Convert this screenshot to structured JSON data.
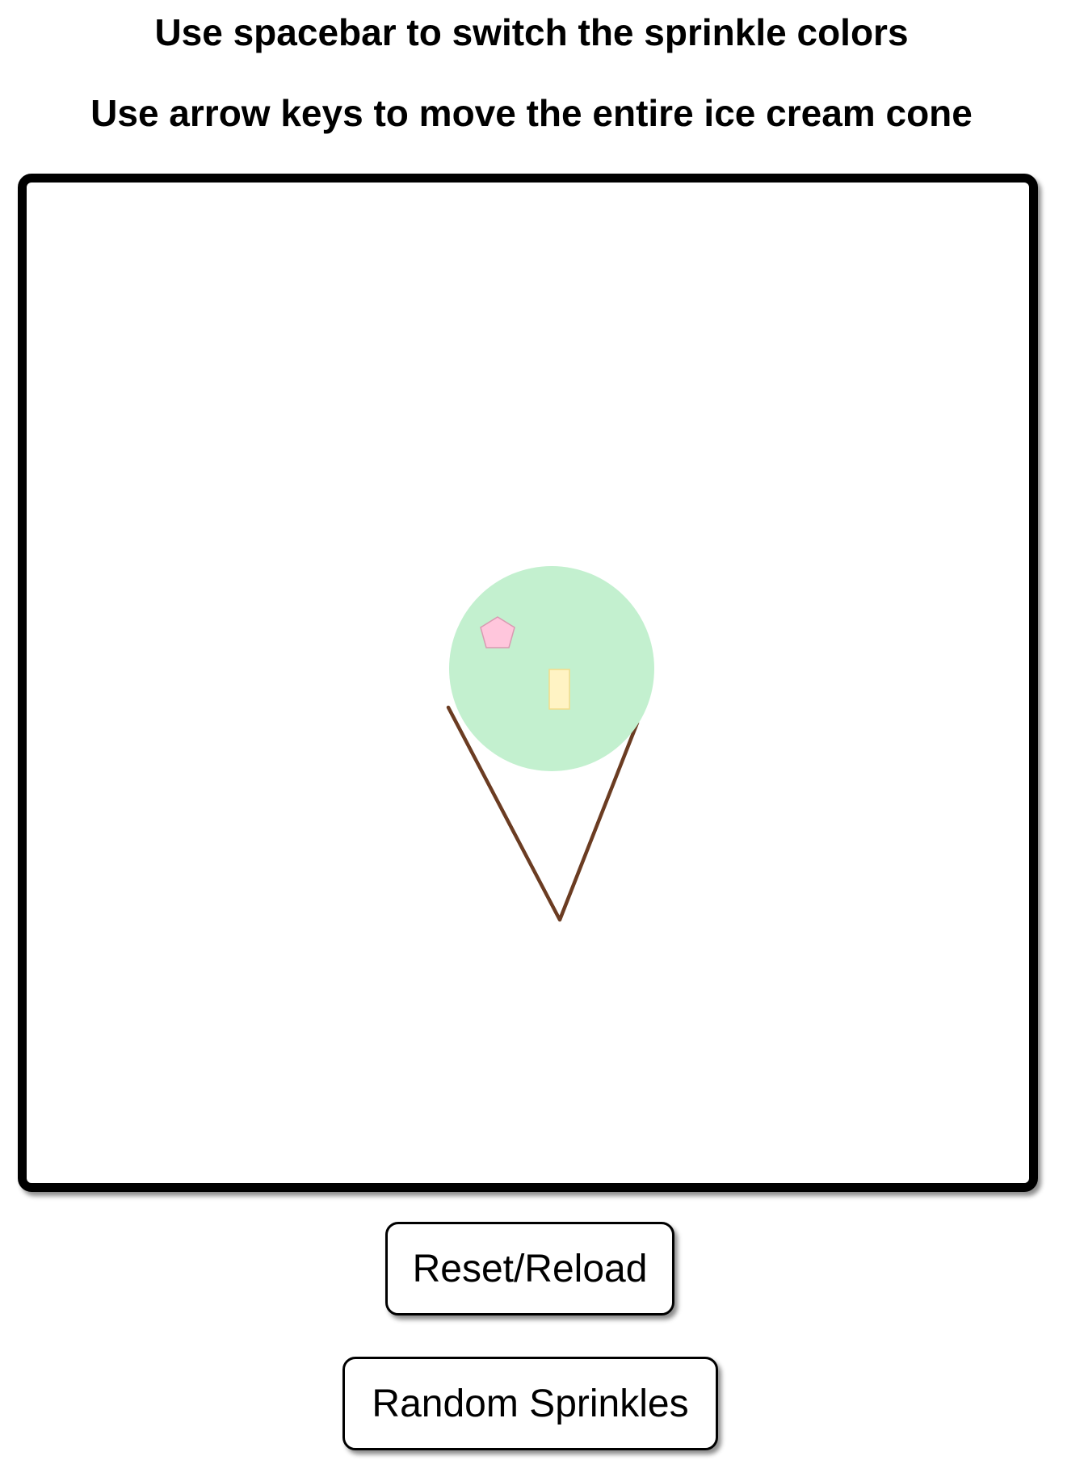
{
  "instructions": {
    "line1": "Use spacebar to switch the sprinkle colors",
    "line2": "Use arrow keys to move the entire ice cream cone"
  },
  "scene": {
    "scoop_color": "#c3f0cf",
    "cone_color": "#6b3c22",
    "sprinkles": [
      {
        "shape": "pentagon",
        "fill": "#ffc6dc",
        "stroke": "#d99ab2"
      },
      {
        "shape": "rectangle",
        "fill": "#fff3c4",
        "stroke": "#f2dc8c"
      }
    ]
  },
  "buttons": {
    "reset_label": "Reset/Reload",
    "random_label": "Random Sprinkles"
  }
}
